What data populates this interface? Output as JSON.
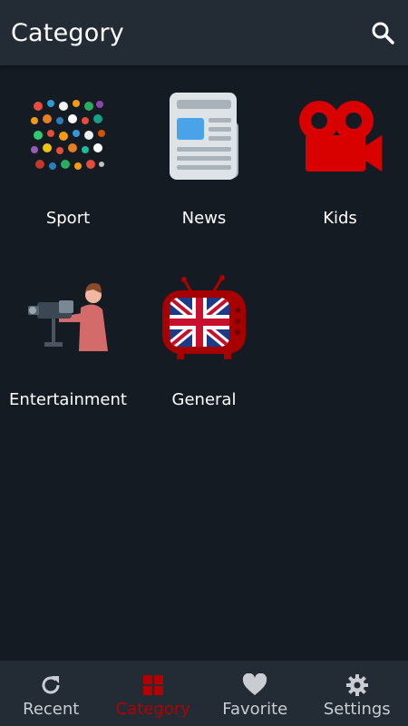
{
  "app_bar": {
    "title": "Category",
    "search_icon": "search-icon"
  },
  "categories": [
    {
      "label": "Sport",
      "icon": "sport-balls-icon"
    },
    {
      "label": "News",
      "icon": "newspaper-icon"
    },
    {
      "label": "Kids",
      "icon": "video-camera-icon"
    },
    {
      "label": "Entertainment",
      "icon": "cameraman-icon"
    },
    {
      "label": "General",
      "icon": "uk-flag-tv-icon"
    }
  ],
  "bottom_nav": {
    "items": [
      {
        "label": "Recent",
        "icon": "refresh-icon"
      },
      {
        "label": "Category",
        "icon": "category-grid-icon"
      },
      {
        "label": "Favorite",
        "icon": "heart-icon"
      },
      {
        "label": "Settings",
        "icon": "gear-icon"
      }
    ],
    "active_index": 1
  },
  "colors": {
    "background": "#141b23",
    "bar": "#232c35",
    "accent": "#b30000",
    "inactive": "#c9cdd1"
  }
}
